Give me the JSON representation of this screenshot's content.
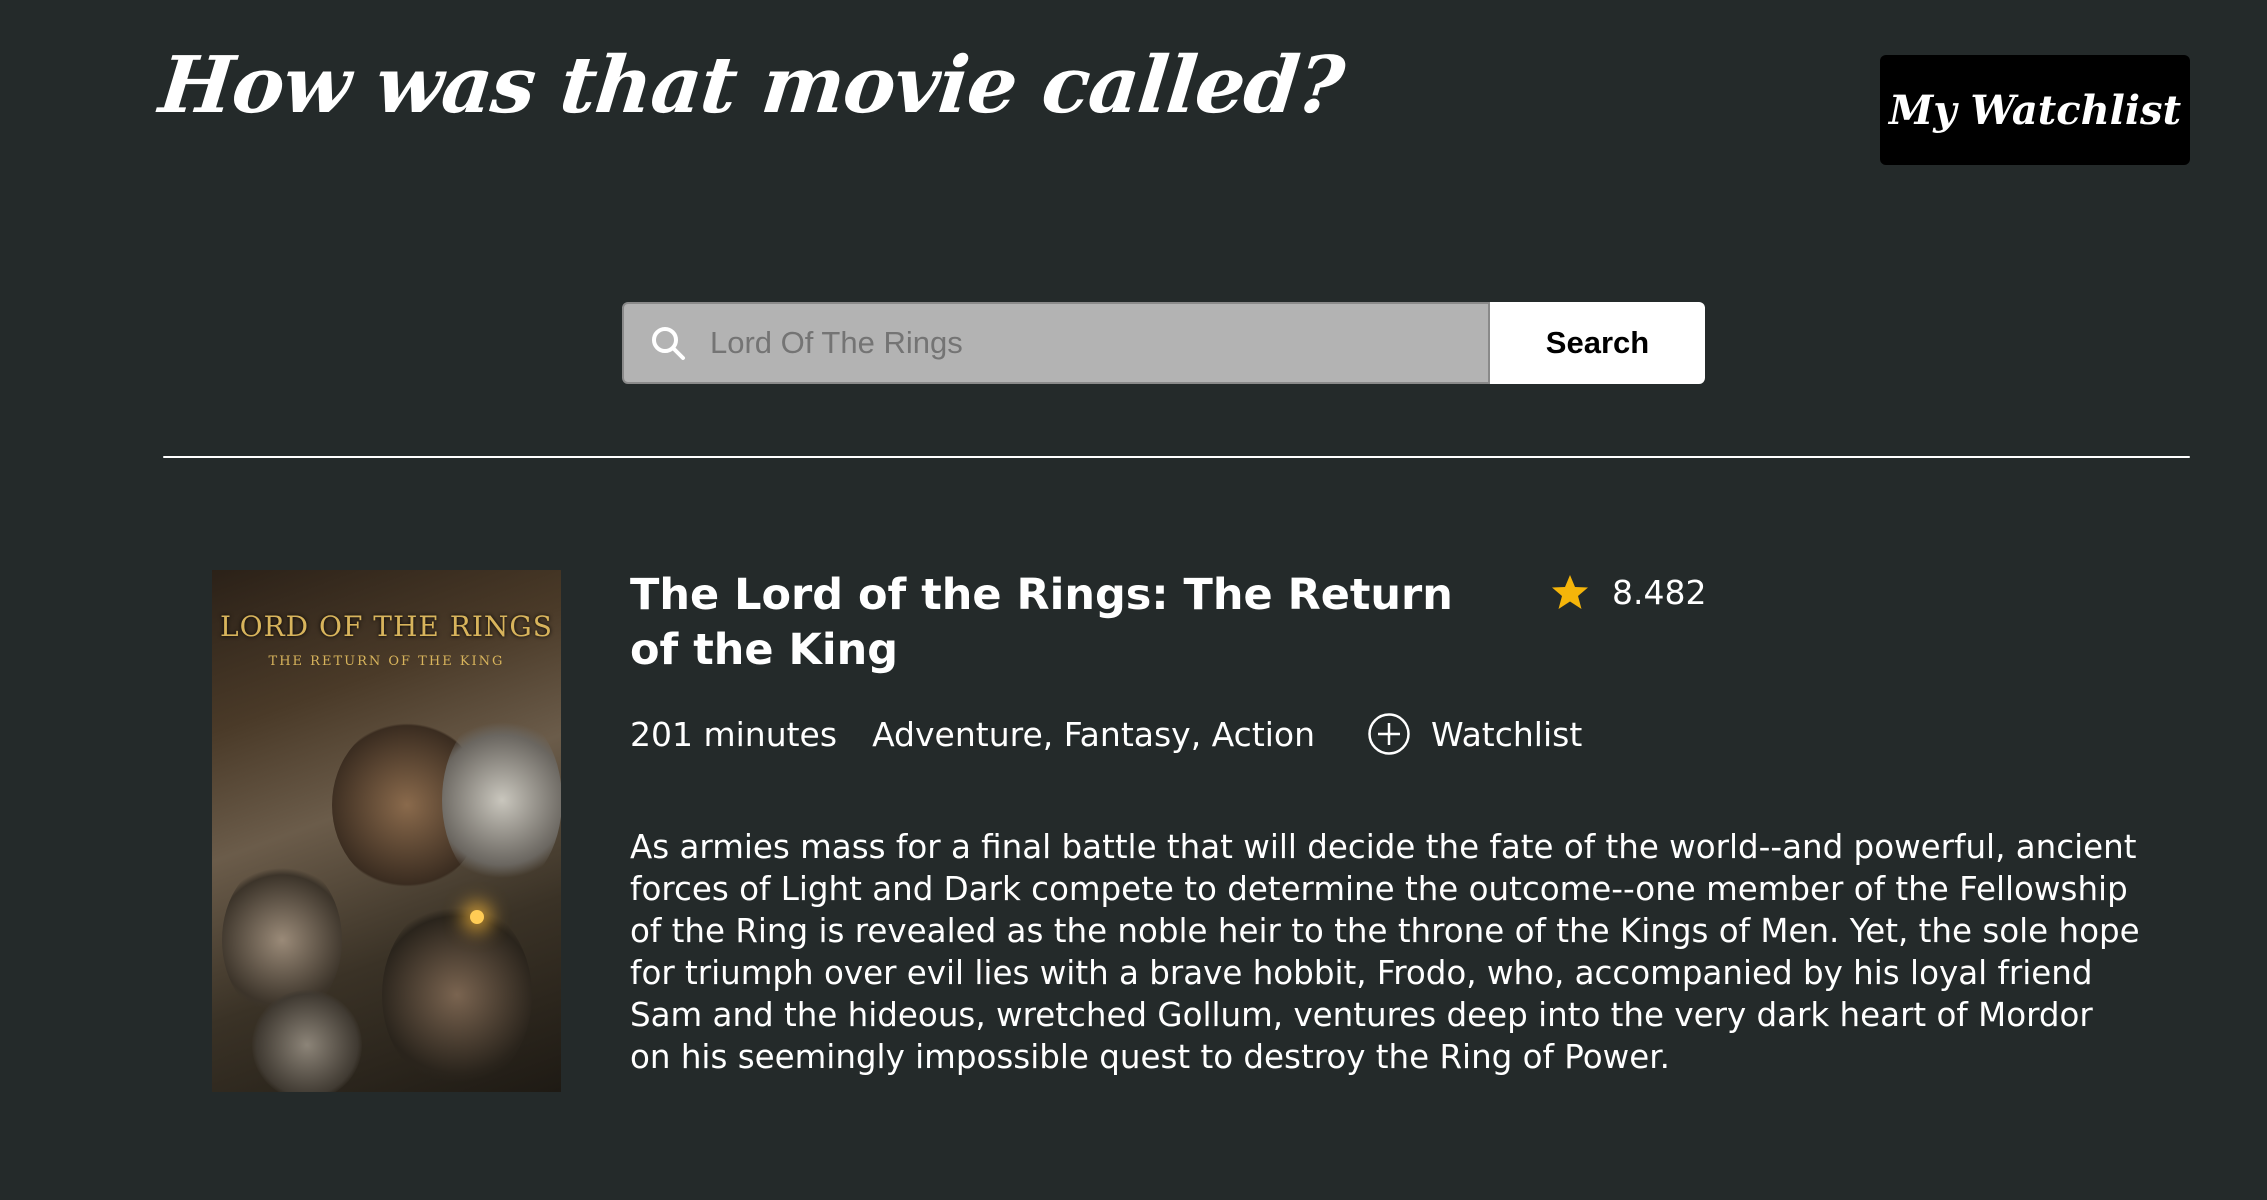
{
  "header": {
    "site_title": "How was that movie called?",
    "watchlist_button_label": "My Watchlist"
  },
  "search": {
    "placeholder": "Lord Of The Rings",
    "value": "",
    "button_label": "Search"
  },
  "result": {
    "title": "The Lord of the Rings: The Return of the King",
    "rating": "8.482",
    "runtime": "201 minutes",
    "genres": "Adventure, Fantasy, Action",
    "watchlist_label": "Watchlist",
    "overview": "As armies mass for a final battle that will decide the fate of the world--and powerful, ancient forces of Light and Dark compete to determine the outcome--one member of the Fellowship of the Ring is revealed as the noble heir to the throne of the Kings of Men. Yet, the sole hope for triumph over evil lies with a brave hobbit, Frodo, who, accompanied by his loyal friend Sam and the hideous, wretched Gollum, ventures deep into the very dark heart of Mordor on his seemingly impossible quest to destroy the Ring of Power.",
    "poster": {
      "title": "LORD OF THE RINGS",
      "subtitle": "THE RETURN OF THE KING"
    }
  },
  "icons": {
    "search": "search-icon",
    "star": "star-icon",
    "add": "plus-circle-icon"
  },
  "colors": {
    "background": "#242a2a",
    "star": "#f5b50a",
    "search_field": "#b3b3b3",
    "watchlist_button": "#000000"
  }
}
